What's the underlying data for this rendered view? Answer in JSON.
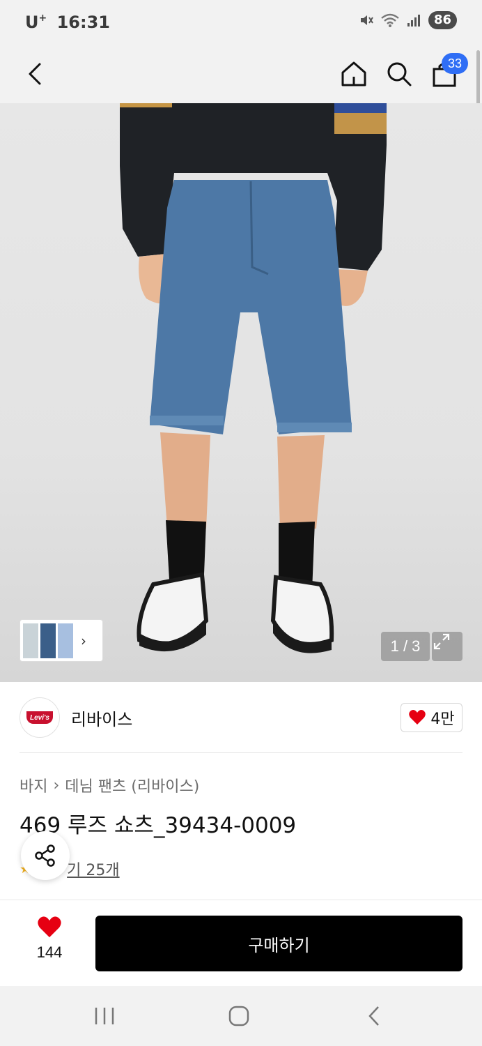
{
  "status_bar": {
    "carrier": "U",
    "carrier_sup": "+",
    "time": "16:31",
    "battery": "86",
    "icons": [
      "mute-icon",
      "wifi-icon",
      "signal-icon"
    ]
  },
  "header": {
    "icons": [
      "back-arrow-icon",
      "home-icon",
      "search-icon",
      "shopping-bag-icon"
    ],
    "cart_count": "33"
  },
  "gallery": {
    "page_indicator": "1 / 3",
    "thumbnail_chevron": "›"
  },
  "brand": {
    "logo_text": "Levi's",
    "name": "리바이스",
    "likes": "4만",
    "accent": "#c8102e"
  },
  "product": {
    "breadcrumb": [
      "바지",
      "데님 팬츠 (리바이스)"
    ],
    "breadcrumb_sep": "›",
    "title": "469 루즈 쇼츠_39434-0009",
    "review_prefix": "후",
    "review_text": "후기 25개",
    "review_link": "기 25개"
  },
  "purchase_bar": {
    "wish_count": "144",
    "buy_label": "구매하기"
  },
  "colors": {
    "heart": "#e60012",
    "badge": "#2f6ef5",
    "button": "#000000"
  }
}
